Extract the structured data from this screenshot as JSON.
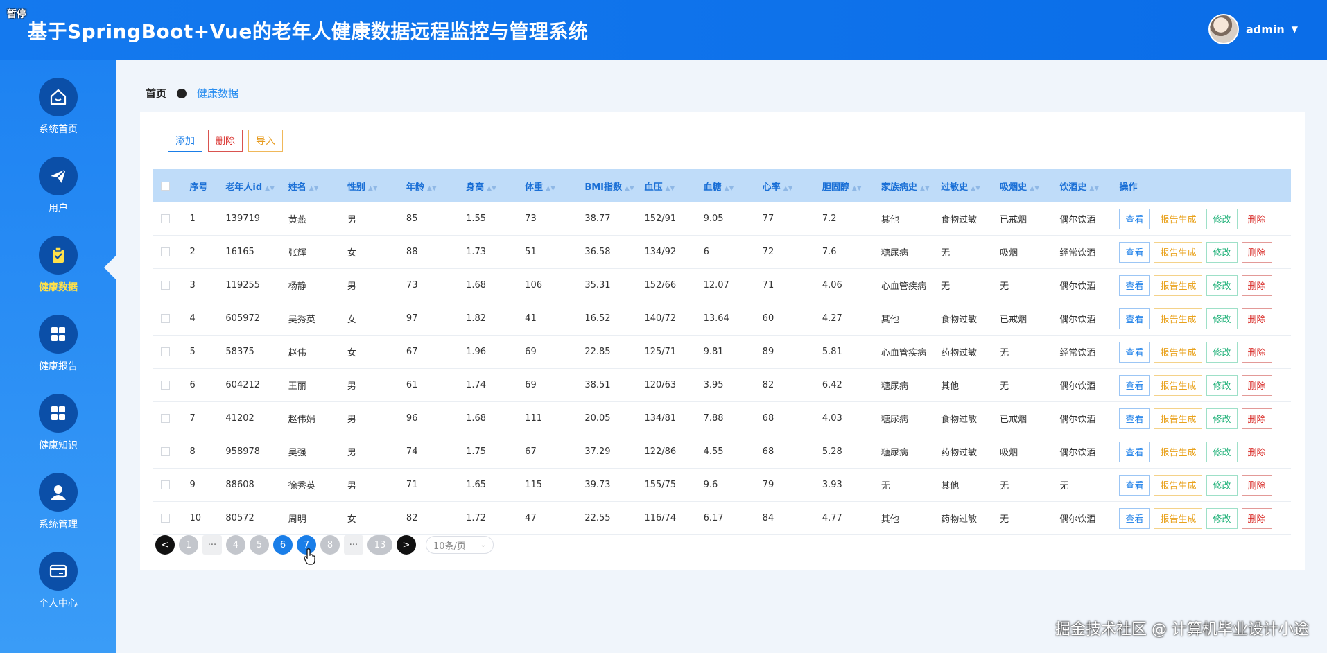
{
  "overlay": {
    "paused": "暂停"
  },
  "header": {
    "title": "基于SpringBoot+Vue的老年人健康数据远程监控与管理系统",
    "username": "admin"
  },
  "sidebar": {
    "items": [
      {
        "label": "系统首页",
        "icon": "home-icon"
      },
      {
        "label": "用户",
        "icon": "paper-plane-icon"
      },
      {
        "label": "健康数据",
        "icon": "clipboard-check-icon",
        "active": true
      },
      {
        "label": "健康报告",
        "icon": "grid-icon"
      },
      {
        "label": "健康知识",
        "icon": "grid-icon"
      },
      {
        "label": "系统管理",
        "icon": "user-icon"
      },
      {
        "label": "个人中心",
        "icon": "card-icon"
      }
    ]
  },
  "breadcrumb": {
    "home": "首页",
    "current": "健康数据"
  },
  "toolbar": {
    "add": "添加",
    "delete": "删除",
    "import": "导入"
  },
  "table": {
    "columns": [
      "序号",
      "老年人id",
      "姓名",
      "性别",
      "年龄",
      "身高",
      "体重",
      "BMI指数",
      "血压",
      "血糖",
      "心率",
      "胆固醇",
      "家族病史",
      "过敏史",
      "吸烟史",
      "饮酒史",
      "操作"
    ],
    "rows": [
      [
        "1",
        "139719",
        "黄燕",
        "男",
        "85",
        "1.55",
        "73",
        "38.77",
        "152/91",
        "9.05",
        "77",
        "7.2",
        "其他",
        "食物过敏",
        "已戒烟",
        "偶尔饮酒"
      ],
      [
        "2",
        "16165",
        "张辉",
        "女",
        "88",
        "1.73",
        "51",
        "36.58",
        "134/92",
        "6",
        "72",
        "7.6",
        "糖尿病",
        "无",
        "吸烟",
        "经常饮酒"
      ],
      [
        "3",
        "119255",
        "杨静",
        "男",
        "73",
        "1.68",
        "106",
        "35.31",
        "152/66",
        "12.07",
        "71",
        "4.06",
        "心血管疾病",
        "无",
        "无",
        "偶尔饮酒"
      ],
      [
        "4",
        "605972",
        "吴秀英",
        "女",
        "97",
        "1.82",
        "41",
        "16.52",
        "140/72",
        "13.64",
        "60",
        "4.27",
        "其他",
        "食物过敏",
        "已戒烟",
        "偶尔饮酒"
      ],
      [
        "5",
        "58375",
        "赵伟",
        "女",
        "67",
        "1.96",
        "69",
        "22.85",
        "125/71",
        "9.81",
        "89",
        "5.81",
        "心血管疾病",
        "药物过敏",
        "无",
        "经常饮酒"
      ],
      [
        "6",
        "604212",
        "王丽",
        "男",
        "61",
        "1.74",
        "69",
        "38.51",
        "120/63",
        "3.95",
        "82",
        "6.42",
        "糖尿病",
        "其他",
        "无",
        "偶尔饮酒"
      ],
      [
        "7",
        "41202",
        "赵伟娟",
        "男",
        "96",
        "1.68",
        "111",
        "20.05",
        "134/81",
        "7.88",
        "68",
        "4.03",
        "糖尿病",
        "食物过敏",
        "已戒烟",
        "偶尔饮酒"
      ],
      [
        "8",
        "958978",
        "吴强",
        "男",
        "74",
        "1.75",
        "67",
        "37.29",
        "122/86",
        "4.55",
        "68",
        "5.28",
        "糖尿病",
        "药物过敏",
        "吸烟",
        "偶尔饮酒"
      ],
      [
        "9",
        "88608",
        "徐秀英",
        "男",
        "71",
        "1.65",
        "115",
        "39.73",
        "155/75",
        "9.6",
        "79",
        "3.93",
        "无",
        "其他",
        "无",
        "无"
      ],
      [
        "10",
        "80572",
        "周明",
        "女",
        "82",
        "1.72",
        "47",
        "22.55",
        "116/74",
        "6.17",
        "84",
        "4.77",
        "其他",
        "药物过敏",
        "无",
        "偶尔饮酒"
      ]
    ],
    "row_actions": {
      "view": "查看",
      "report": "报告生成",
      "edit": "修改",
      "delete": "删除"
    }
  },
  "pagination": {
    "prev": "<",
    "next": ">",
    "items": [
      "1",
      "···",
      "4",
      "5",
      "6",
      "7",
      "8",
      "···",
      "13"
    ],
    "current": "6",
    "highlighted": "7",
    "page_size": "10条/页"
  },
  "watermark": "掘金技术社区 @ 计算机毕业设计小途"
}
